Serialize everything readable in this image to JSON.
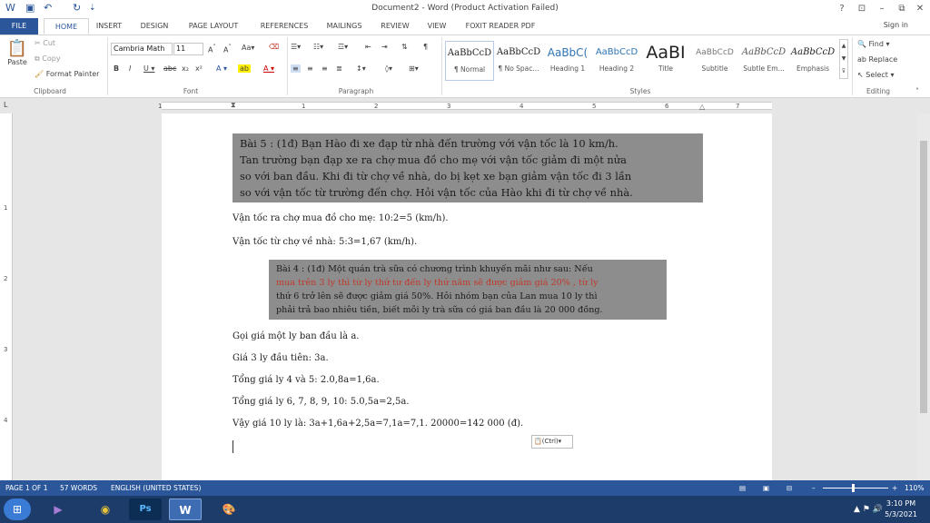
{
  "window": {
    "title": "Document2 - Word (Product Activation Failed)",
    "help": "?",
    "restore_ribbon": "⊡",
    "minimize": "–",
    "maximize": "⧉",
    "close": "✕"
  },
  "quick_access": {
    "save_icon": "💾",
    "undo_icon": "↶",
    "redo_icon": "↻",
    "more": "⇣"
  },
  "tabs": [
    "FILE",
    "HOME",
    "INSERT",
    "DESIGN",
    "PAGE LAYOUT",
    "REFERENCES",
    "MAILINGS",
    "REVIEW",
    "VIEW",
    "FOXIT READER PDF"
  ],
  "sign_in": "Sign in",
  "clipboard": {
    "paste": "Paste",
    "cut": "Cut",
    "copy": "Copy",
    "format_painter": "Format Painter",
    "group": "Clipboard"
  },
  "font": {
    "name": "Cambria Math",
    "size": "11",
    "group": "Font"
  },
  "paragraph": {
    "group": "Paragraph"
  },
  "styles": {
    "group": "Styles",
    "items": [
      {
        "preview": "AaBbCcD",
        "name": "¶ Normal"
      },
      {
        "preview": "AaBbCcD",
        "name": "¶ No Spac..."
      },
      {
        "preview": "AaBbC(",
        "name": "Heading 1"
      },
      {
        "preview": "AaBbCcD",
        "name": "Heading 2"
      },
      {
        "preview": "AaBI",
        "name": "Title"
      },
      {
        "preview": "AaBbCcD",
        "name": "Subtitle"
      },
      {
        "preview": "AaBbCcD",
        "name": "Subtle Em..."
      },
      {
        "preview": "AaBbCcD",
        "name": "Emphasis"
      }
    ]
  },
  "editing": {
    "find": "Find",
    "replace": "Replace",
    "select": "Select",
    "group": "Editing"
  },
  "ruler": {
    "numbers": [
      "1",
      "1",
      "2",
      "3",
      "4",
      "5",
      "6",
      "7"
    ],
    "v_numbers": [
      "1",
      "2",
      "3",
      "4"
    ]
  },
  "document": {
    "image1_lines": [
      "Bài 5 : (1đ) Bạn Hào đi xe đạp từ nhà đến trường với vận tốc là 10 km/h.",
      "Tan trường bạn đạp xe ra chợ mua đồ cho mẹ với vận tốc giảm đi một nửa",
      "so với ban đầu. Khi đi từ chợ về nhà, do bị kẹt xe bạn giảm vận tốc đi 3 lần",
      "so với vận tốc từ trường đến chợ. Hỏi vận tốc của Hào khi đi từ chợ về nhà."
    ],
    "line1": "Vận tốc ra chợ mua đồ cho mẹ: 10:2=5 (km/h).",
    "line2": "Vận tốc từ chợ về nhà: 5:3=1,67 (km/h).",
    "image2_lines": [
      "Bài 4 : (1đ) Một quán trà sữa có chương trình khuyến mãi như sau: Nếu",
      "mua trên 3 ly thì từ ly thứ tư đến ly thứ năm sẽ được giảm giá 20% , từ ly",
      "thứ 6 trở lên sẽ được giảm giá 50%. Hỏi nhóm bạn của Lan mua 10 ly thì",
      "phải trả bao nhiêu tiền, biết mỗi ly trà sữa có giá ban đầu là 20 000 đồng."
    ],
    "line3": "Gọi giá một ly ban đầu là a.",
    "line4": "Giá 3 ly đầu tiên: 3a.",
    "line5": "Tổng giá ly 4 và 5: 2.0,8a=1,6a.",
    "line6": "Tổng giá ly 6, 7, 8, 9, 10: 5.0,5a=2,5a.",
    "line7": "Vậy giá 10 ly là: 3a+1,6a+2,5a=7,1a=7,1. 20000=142 000 (đ).",
    "paste_options": "(Ctrl)"
  },
  "status": {
    "page": "PAGE 1 OF 1",
    "words": "57 WORDS",
    "language": "ENGLISH (UNITED STATES)",
    "zoom": "110%"
  },
  "taskbar": {
    "time": "3:10 PM",
    "date": "5/3/2021",
    "apps": [
      "start-orb",
      "visual-studio",
      "chrome",
      "photoshop",
      "word",
      "paint"
    ]
  },
  "colors": {
    "accent": "#2b579a",
    "taskbar": "#1e3c6a"
  }
}
